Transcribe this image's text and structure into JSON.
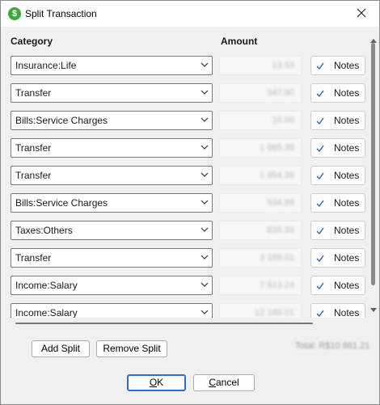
{
  "window": {
    "title": "Split Transaction",
    "app_icon_glyph": "$",
    "close_icon": "close-icon",
    "accent": "#3fa83a"
  },
  "columns": {
    "category": "Category",
    "amount": "Amount"
  },
  "rows": [
    {
      "category": "Insurance:Life",
      "amount": "13.53",
      "notes_label": "Notes"
    },
    {
      "category": "Transfer",
      "amount": "347.90",
      "notes_label": "Notes"
    },
    {
      "category": "Bills:Service Charges",
      "amount": "16.00",
      "notes_label": "Notes"
    },
    {
      "category": "Transfer",
      "amount": "1 965.39",
      "notes_label": "Notes"
    },
    {
      "category": "Transfer",
      "amount": "1 954.39",
      "notes_label": "Notes"
    },
    {
      "category": "Bills:Service Charges",
      "amount": "534.89",
      "notes_label": "Notes"
    },
    {
      "category": "Taxes:Others",
      "amount": "835.34",
      "notes_label": "Notes"
    },
    {
      "category": "Transfer",
      "amount": "3 188.01",
      "notes_label": "Notes"
    },
    {
      "category": "Income:Salary",
      "amount": "7 813.24",
      "notes_label": "Notes"
    },
    {
      "category": "Income:Salary",
      "amount": "12 188.01",
      "notes_label": "Notes"
    }
  ],
  "buttons": {
    "add_split": "Add Split",
    "remove_split": "Remove Split",
    "ok_accel": "O",
    "ok_rest": "K",
    "cancel_accel": "C",
    "cancel_rest": "ancel"
  },
  "total_text": "Total: R$10 861.21"
}
